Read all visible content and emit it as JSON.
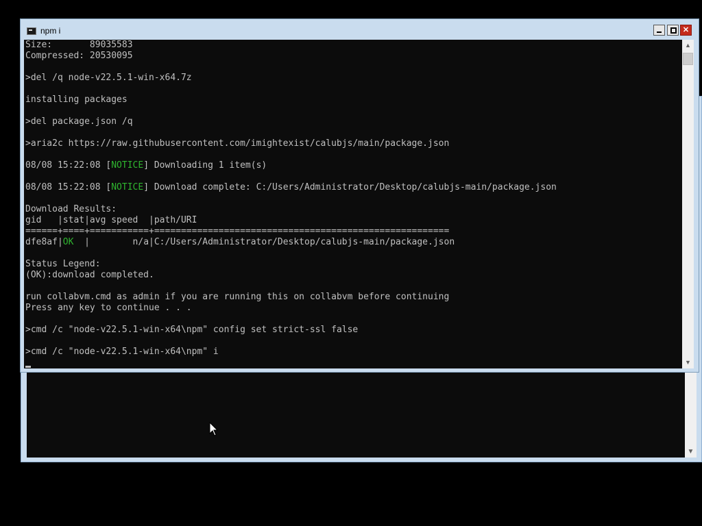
{
  "window": {
    "title": "npm i",
    "buttons": {
      "minimize": "",
      "maximize": "",
      "close": "✕"
    }
  },
  "console": {
    "lines": [
      [
        {
          "t": "Size:       89035583"
        }
      ],
      [
        {
          "t": "Compressed: 20530095"
        }
      ],
      [
        {
          "t": ""
        }
      ],
      [
        {
          "t": ">del /q node-v22.5.1-win-x64.7z"
        }
      ],
      [
        {
          "t": ""
        }
      ],
      [
        {
          "t": "installing packages"
        }
      ],
      [
        {
          "t": ""
        }
      ],
      [
        {
          "t": ">del package.json /q"
        }
      ],
      [
        {
          "t": ""
        }
      ],
      [
        {
          "t": ">aria2c https://raw.githubusercontent.com/imightexist/calubjs/main/package.json"
        }
      ],
      [
        {
          "t": ""
        }
      ],
      [
        {
          "t": "08/08 15:22:08 ["
        },
        {
          "t": "NOTICE",
          "hl": true
        },
        {
          "t": "] Downloading 1 item(s)"
        }
      ],
      [
        {
          "t": ""
        }
      ],
      [
        {
          "t": "08/08 15:22:08 ["
        },
        {
          "t": "NOTICE",
          "hl": true
        },
        {
          "t": "] Download complete: C:/Users/Administrator/Desktop/calubjs-main/package.json"
        }
      ],
      [
        {
          "t": ""
        }
      ],
      [
        {
          "t": "Download Results:"
        }
      ],
      [
        {
          "t": "gid   |stat|avg speed  |path/URI"
        }
      ],
      [
        {
          "t": "======+====+===========+======================================================="
        }
      ],
      [
        {
          "t": "dfe8af|"
        },
        {
          "t": "OK",
          "hl": true
        },
        {
          "t": "  |        n/a|C:/Users/Administrator/Desktop/calubjs-main/package.json"
        }
      ],
      [
        {
          "t": ""
        }
      ],
      [
        {
          "t": "Status Legend:"
        }
      ],
      [
        {
          "t": "(OK):download completed."
        }
      ],
      [
        {
          "t": ""
        }
      ],
      [
        {
          "t": "run collabvm.cmd as admin if you are running this on collabvm before continuing"
        }
      ],
      [
        {
          "t": "Press any key to continue . . ."
        }
      ],
      [
        {
          "t": ""
        }
      ],
      [
        {
          "t": ">cmd /c \"node-v22.5.1-win-x64\\npm\" config set strict-ssl false"
        }
      ],
      [
        {
          "t": ""
        }
      ],
      [
        {
          "t": ">cmd /c \"node-v22.5.1-win-x64\\npm\" i"
        }
      ]
    ],
    "text_color": "#c0c0c0",
    "highlight_color": "#2fb52f",
    "background": "#0c0c0c"
  },
  "scrollbar": {
    "up_icon": "▲",
    "down_icon": "▼"
  },
  "background_window": {
    "scroll_down_icon": "▼"
  }
}
